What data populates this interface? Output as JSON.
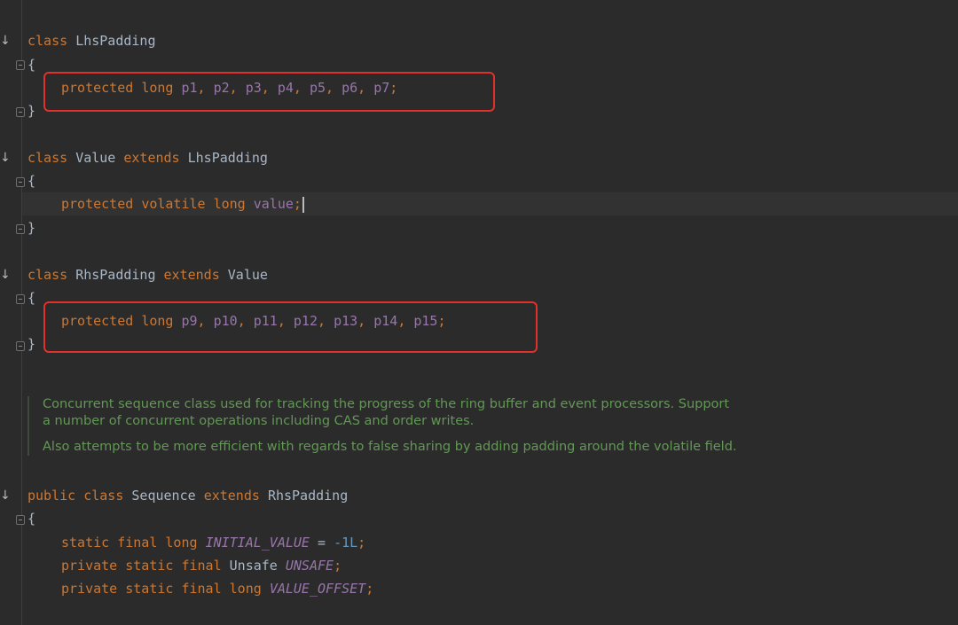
{
  "code": {
    "kw_class": "class",
    "kw_public": "public",
    "kw_extends": "extends",
    "kw_protected": "protected",
    "kw_private": "private",
    "kw_static": "static",
    "kw_final": "final",
    "kw_volatile": "volatile",
    "kw_long": "long",
    "brace_open": "{",
    "brace_close": "}",
    "semicolon": ";",
    "comma_space": ", ",
    "equals": " = ",
    "class_lhs": "LhsPadding",
    "class_value": "Value",
    "class_rhs": "RhsPadding",
    "class_sequence": "Sequence",
    "type_unsafe": "Unsafe",
    "lhs_fields": [
      "p1",
      "p2",
      "p3",
      "p4",
      "p5",
      "p6",
      "p7"
    ],
    "value_field": "value",
    "rhs_fields": [
      "p9",
      "p10",
      "p11",
      "p12",
      "p13",
      "p14",
      "p15"
    ],
    "const_initial": "INITIAL_VALUE",
    "const_initial_value": "-1L",
    "const_unsafe": "UNSAFE",
    "const_offset": "VALUE_OFFSET"
  },
  "doc_comment": {
    "para1": "Concurrent sequence class used for tracking the progress of the ring buffer and event processors. Support a number of concurrent operations including CAS and order writes.",
    "para2": "Also attempts to be more efficient with regards to false sharing by adding padding around the volatile field."
  },
  "gutter": {
    "implemented_marker": "↓"
  },
  "colors": {
    "background": "#2b2b2b",
    "keyword": "#cc7832",
    "identifier": "#a9b7c6",
    "field": "#9876aa",
    "number": "#6897bb",
    "doc_comment": "#629755",
    "annotation_box": "#e0312b"
  }
}
